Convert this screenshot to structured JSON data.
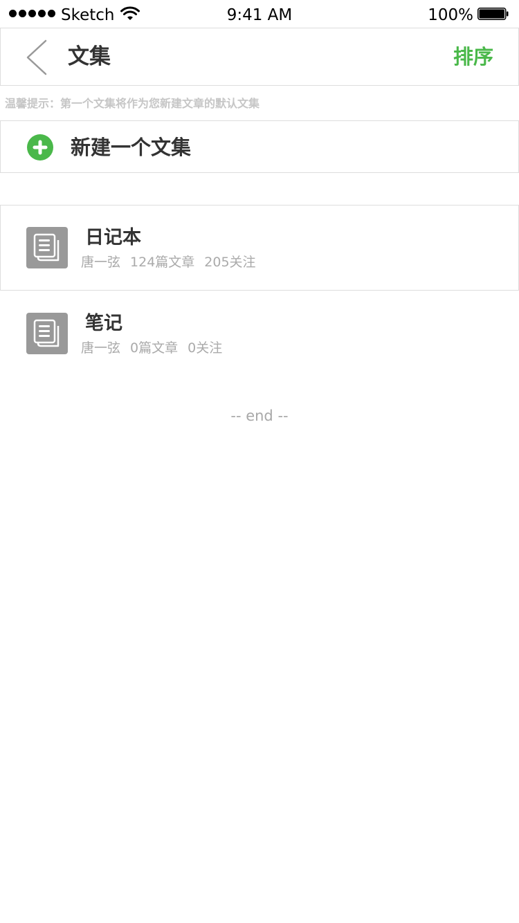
{
  "status_bar": {
    "carrier": "Sketch",
    "time": "9:41 AM",
    "battery_percent": "100%",
    "signal_icon": "signal-dots-icon",
    "wifi_icon": "wifi-icon",
    "battery_icon": "battery-icon"
  },
  "nav": {
    "back_icon": "chevron-left-icon",
    "title": "文集",
    "sort_label": "排序"
  },
  "hint": "温馨提示：第一个文集将作为您新建文章的默认文集",
  "new_collection": {
    "icon": "plus-circle-icon",
    "label": "新建一个文集"
  },
  "collections": [
    {
      "icon": "notebook-icon",
      "title": "日记本",
      "author": "唐一弦",
      "articles": "124篇文章",
      "followers": "205关注"
    },
    {
      "icon": "notebook-icon",
      "title": "笔记",
      "author": "唐一弦",
      "articles": "0篇文章",
      "followers": "0关注"
    }
  ],
  "end_text": "-- end --",
  "colors": {
    "accent_green": "#4ab84a",
    "icon_gray": "#999999",
    "border": "#dddddd",
    "muted_text": "#aaaaaa"
  }
}
